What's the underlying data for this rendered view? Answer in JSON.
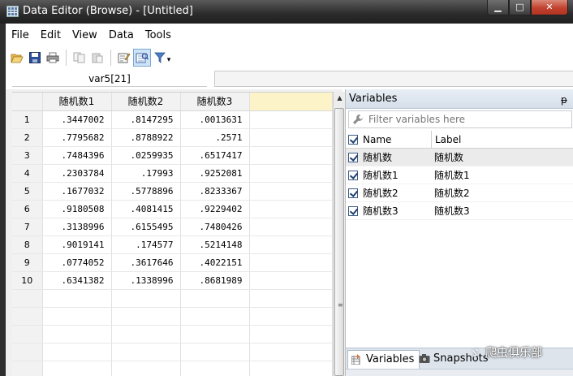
{
  "window": {
    "title": "Data Editor (Browse) - [Untitled]",
    "buttons": {
      "minimize": "▁",
      "maximize": "□",
      "close": "✕"
    }
  },
  "menu": [
    "File",
    "Edit",
    "View",
    "Data",
    "Tools"
  ],
  "toolbar": {
    "icons": [
      "open-icon",
      "save-icon",
      "print-icon",
      "copy-icon",
      "paste-icon",
      "edit-mode-icon",
      "browse-mode-icon",
      "filter-icon"
    ],
    "filter_dropdown": "▾"
  },
  "cell_ref": "var5[21]",
  "grid": {
    "columns": [
      "随机数1",
      "随机数2",
      "随机数3"
    ],
    "rows": [
      {
        "n": "1",
        "v": [
          ".3447002",
          ".8147295",
          ".0013631"
        ]
      },
      {
        "n": "2",
        "v": [
          ".7795682",
          ".8788922",
          ".2571"
        ]
      },
      {
        "n": "3",
        "v": [
          ".7484396",
          ".0259935",
          ".6517417"
        ]
      },
      {
        "n": "4",
        "v": [
          ".2303784",
          ".17993",
          ".9252081"
        ]
      },
      {
        "n": "5",
        "v": [
          ".1677032",
          ".5778896",
          ".8233367"
        ]
      },
      {
        "n": "6",
        "v": [
          ".9180508",
          ".4081415",
          ".9229402"
        ]
      },
      {
        "n": "7",
        "v": [
          ".3138996",
          ".6155495",
          ".7480426"
        ]
      },
      {
        "n": "8",
        "v": [
          ".9019141",
          ".174577",
          ".5214148"
        ]
      },
      {
        "n": "9",
        "v": [
          ".0774052",
          ".3617646",
          ".4022151"
        ]
      },
      {
        "n": "10",
        "v": [
          ".6341382",
          ".1338996",
          ".8681989"
        ]
      }
    ]
  },
  "variables_panel": {
    "title": "Variables",
    "pin": "ᵽ",
    "filter_placeholder": "Filter variables here",
    "headers": {
      "name": "Name",
      "label": "Label"
    },
    "items": [
      {
        "name": "随机数",
        "label": "随机数"
      },
      {
        "name": "随机数1",
        "label": "随机数1"
      },
      {
        "name": "随机数2",
        "label": "随机数2"
      },
      {
        "name": "随机数3",
        "label": "随机数3"
      }
    ],
    "tabs": [
      "Variables",
      "Snapshots"
    ]
  },
  "watermark": "爬虫俱乐部",
  "colors": {
    "titlebar": "#2b2b2b",
    "panel_header": "#d5dfea",
    "header_highlight": "#fdf3c8",
    "close": "#c2412e"
  }
}
